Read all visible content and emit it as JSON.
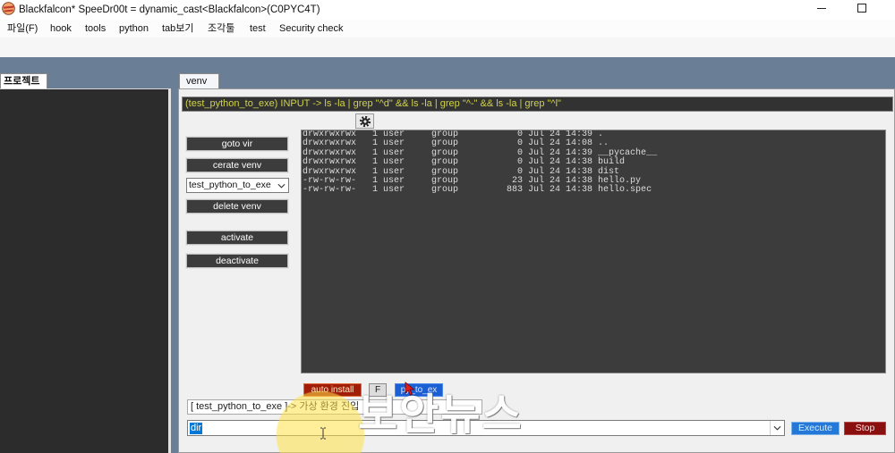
{
  "window": {
    "title": "Blackfalcon* SpeeDr00t = dynamic_cast<Blackfalcon>(C0PYC4T)",
    "icon": "falcon-app-icon",
    "controls": [
      "minimize-icon",
      "maximize-icon"
    ]
  },
  "menu": {
    "items": [
      "파일(F)",
      "hook",
      "tools",
      "python",
      "tab보기",
      "조각툴",
      "test",
      "Security check"
    ]
  },
  "project_panel": {
    "tab_label": "프로젝트"
  },
  "venv": {
    "tab_label": "venv",
    "command_line": "(test_python_to_exe) INPUT -> ls -la | grep \"^d\" && ls -la | grep \"^-\" && ls -la | grep \"^l\"",
    "settings_icon": "gear-icon",
    "sidebar_buttons": {
      "goto_vir": "goto vir",
      "create_venv": "cerate venv",
      "delete_venv": "delete venv",
      "activate": "activate",
      "deactivate": "deactivate"
    },
    "env_select": {
      "selected": "test_python_to_exe",
      "icon": "chevron-down-icon"
    },
    "terminal_output": [
      "drwxrwxrwx   1 user     group           0 Jul 24 14:39 .",
      "drwxrwxrwx   1 user     group           0 Jul 24 14:08 ..",
      "drwxrwxrwx   1 user     group           0 Jul 24 14:39 __pycache__",
      "drwxrwxrwx   1 user     group           0 Jul 24 14:38 build",
      "drwxrwxrwx   1 user     group           0 Jul 24 14:38 dist",
      "-rw-rw-rw-   1 user     group          23 Jul 24 14:38 hello.py",
      "-rw-rw-rw-   1 user     group         883 Jul 24 14:38 hello.spec"
    ],
    "action_buttons": {
      "auto_install": "auto install",
      "f": "F",
      "py_to_exe": "py_to_ex"
    },
    "status_text": "[ test_python_to_exe ]-> 가상 환경 진입",
    "command_input": {
      "value": "dir",
      "icon": "chevron-down-icon"
    },
    "execute_label": "Execute",
    "stop_label": "Stop"
  },
  "overlay": {
    "watermark": "보안뉴스",
    "cursor_highlight_color": "#ffe146",
    "pointer_icon": "mouse-pointer-icon",
    "text_cursor_icon": "text-cursor-icon"
  },
  "colors": {
    "workspace_bg": "#6a7e95",
    "terminal_bg": "#3c3c3c",
    "terminal_text": "#dcdcdc",
    "command_text": "#cfd24a",
    "dark_button": "#3c3c3c",
    "auto_install": "#a11d08",
    "py_to_exe": "#1b5fd4",
    "execute": "#2479d8",
    "stop": "#8a0f0f",
    "selection": "#0078d7"
  }
}
